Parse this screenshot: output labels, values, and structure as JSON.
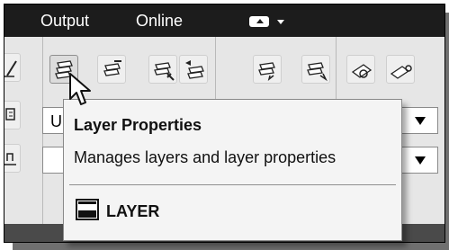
{
  "menubar": {
    "items": [
      "Output",
      "Online"
    ],
    "extra_icon": "workspace-tile-icon"
  },
  "ribbon": {
    "tools": [
      {
        "name": "layer-properties-tool-icon",
        "state": "hover"
      },
      {
        "name": "layer-states-icon"
      },
      {
        "name": "match-layer-icon"
      },
      {
        "name": "previous-layer-icon"
      },
      {
        "name": "layer-isolate-icon"
      },
      {
        "name": "layer-walk-icon"
      },
      {
        "name": "layer-lock-icon"
      },
      {
        "name": "layer-bulb-icon"
      }
    ],
    "combo_top": {
      "value": "U"
    },
    "combo_bottom": {
      "value": ""
    }
  },
  "tooltip": {
    "title": "Layer Properties",
    "description": "Manages layers and layer properties",
    "command_icon": "layer-command-icon",
    "command": "LAYER"
  },
  "cursor": {
    "icon": "arrow-cursor-icon"
  }
}
